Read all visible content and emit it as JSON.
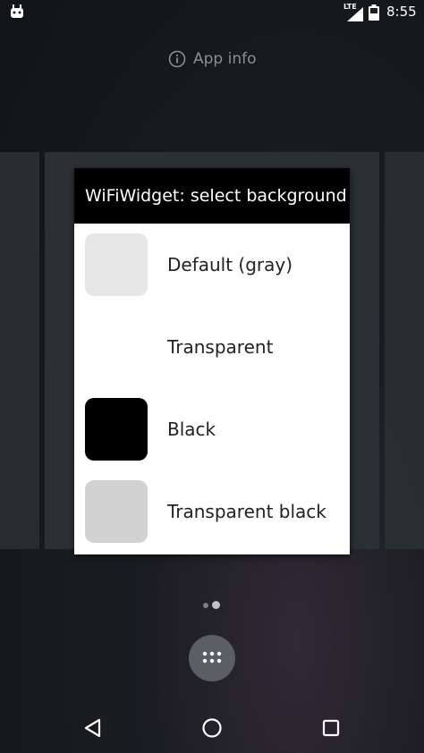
{
  "status_bar": {
    "network_label": "LTE",
    "time": "8:55"
  },
  "app_info": {
    "label": "App info",
    "icon": "info-icon"
  },
  "dialog": {
    "title": "WiFiWidget: select background",
    "options": [
      {
        "label": "Default (gray)",
        "swatch_color": "#e6e6e6"
      },
      {
        "label": "Transparent",
        "swatch_color": "transparent"
      },
      {
        "label": "Black",
        "swatch_color": "#000000"
      },
      {
        "label": "Transparent black",
        "swatch_color": "#d2d2d2"
      }
    ]
  },
  "colors": {
    "dialog_title_bg": "#000000",
    "dialog_bg": "#ffffff",
    "panel_bg": "#2b3133"
  },
  "nav_bar": {
    "back_icon": "back-icon",
    "home_icon": "home-icon",
    "recents_icon": "recents-icon"
  }
}
